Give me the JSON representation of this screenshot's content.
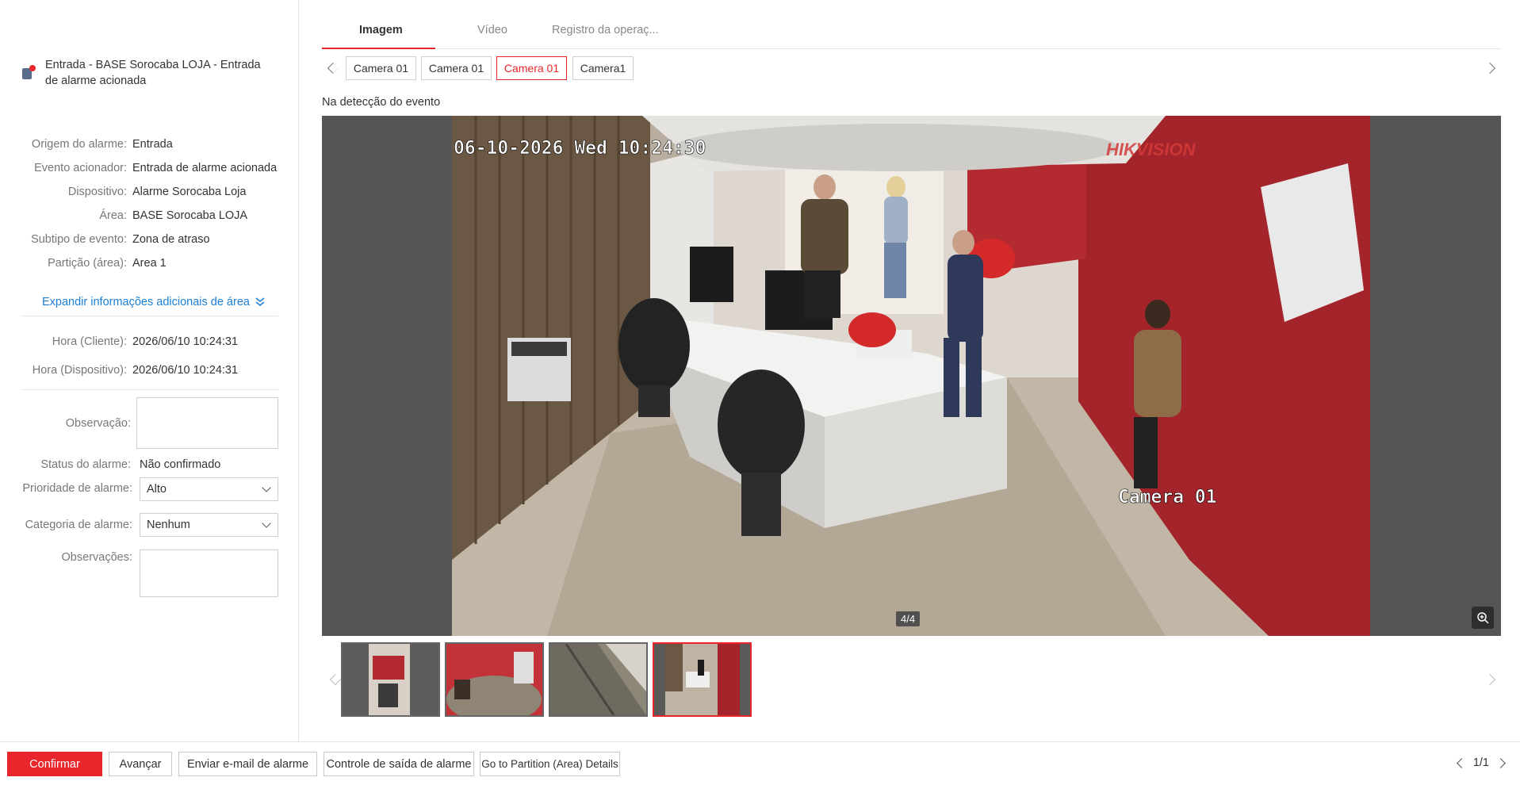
{
  "alarm": {
    "title": "Entrada - BASE Sorocaba LOJA - Entrada de alarme acionada"
  },
  "details": [
    {
      "label": "Origem do alarme:",
      "value": "Entrada"
    },
    {
      "label": "Evento acionador:",
      "value": "Entrada de alarme acionada"
    },
    {
      "label": "Dispositivo:",
      "value": "Alarme Sorocaba Loja"
    },
    {
      "label": "Área:",
      "value": "BASE Sorocaba LOJA"
    },
    {
      "label": "Subtipo de evento:",
      "value": "Zona de atraso"
    },
    {
      "label": "Partição (área):",
      "value": "Area 1"
    }
  ],
  "expand_label": "Expandir informações adicionais de área",
  "times": [
    {
      "label": "Hora (Cliente):",
      "value": "2026/06/10 10:24:31"
    },
    {
      "label": "Hora (Dispositivo):",
      "value": "2026/06/10 10:24:31"
    }
  ],
  "form": {
    "observacao_label": "Observação:",
    "observacao_value": "",
    "status_label": "Status do alarme:",
    "status_value": "Não confirmado",
    "priority_label": "Prioridade de alarme:",
    "priority_value": "Alto",
    "category_label": "Categoria de alarme:",
    "category_value": "Nenhum",
    "observacoes_label": "Observações:",
    "observacoes_value": ""
  },
  "tabs": [
    {
      "label": "Imagem",
      "active": true
    },
    {
      "label": "Vídeo",
      "active": false
    },
    {
      "label": "Registro da operaç...",
      "active": false
    }
  ],
  "cameras": [
    {
      "label": "Camera 01",
      "selected": false
    },
    {
      "label": "Camera 01",
      "selected": false
    },
    {
      "label": "Camera 01",
      "selected": true
    },
    {
      "label": "Camera1",
      "selected": false
    }
  ],
  "event_label": "Na detecção do evento",
  "image": {
    "timestamp": "06-10-2026 Wed 10:24:30",
    "brand": "HIKVISION",
    "camera_name": "Camera 01",
    "counter": "4/4"
  },
  "thumbnails_count": 4,
  "selected_thumbnail": 4,
  "buttons": {
    "confirm": "Confirmar",
    "next": "Avançar",
    "email": "Enviar e-mail de alarme",
    "output": "Controle de saída de alarme",
    "partition": "Go to Partition (Area) Details"
  },
  "pager": "1/1",
  "colors": {
    "accent": "#e8262b",
    "link": "#1a7fd4"
  }
}
